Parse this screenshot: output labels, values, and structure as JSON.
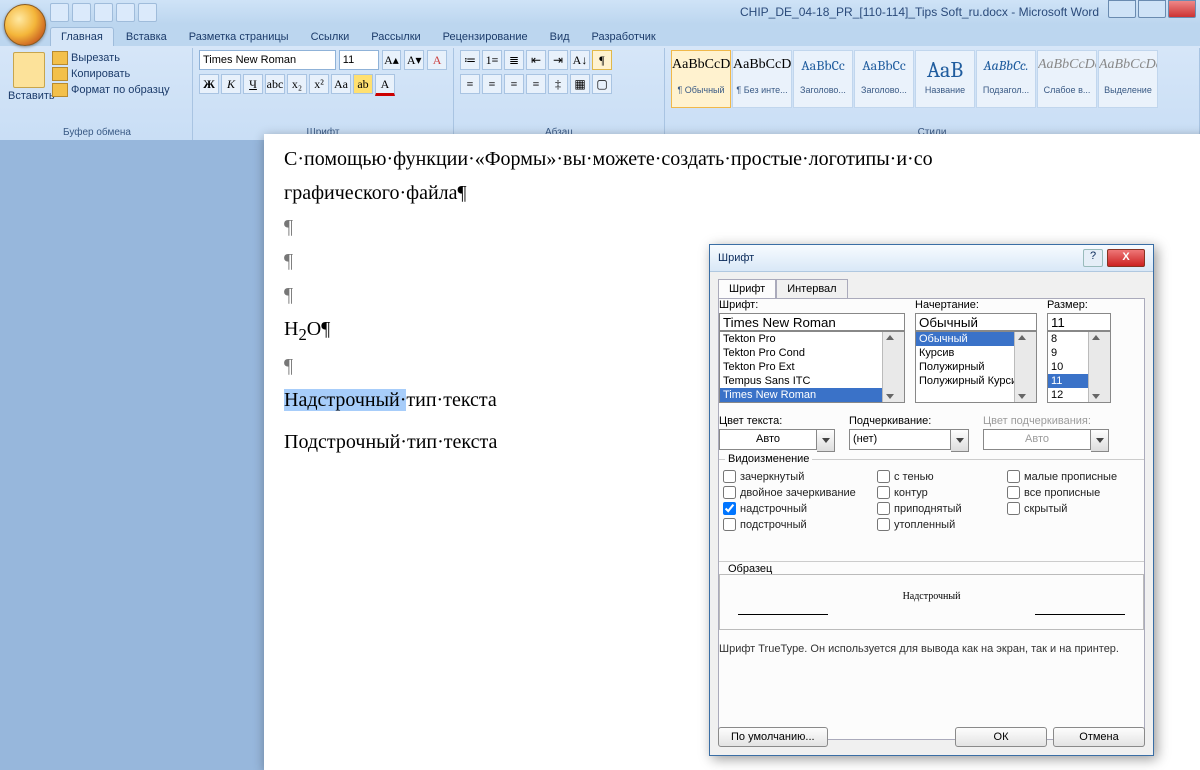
{
  "title_doc": "CHIP_DE_04-18_PR_[110-114]_Tips Soft_ru.docx - Microsoft Word",
  "tabs": [
    "Главная",
    "Вставка",
    "Разметка страницы",
    "Ссылки",
    "Рассылки",
    "Рецензирование",
    "Вид",
    "Разработчик"
  ],
  "ribbon": {
    "paste": "Вставить",
    "cut": "Вырезать",
    "copy": "Копировать",
    "format_painter": "Формат по образцу",
    "group_clipboard": "Буфер обмена",
    "font_name": "Times New Roman",
    "font_size": "11",
    "group_font": "Шрифт",
    "group_para": "Абзац",
    "group_styles": "Стили",
    "styles": [
      {
        "prev": "AaBbCcDd",
        "name": "¶ Обычный",
        "sel": true
      },
      {
        "prev": "AaBbCcDd",
        "name": "¶ Без инте..."
      },
      {
        "prev": "AaBbCc",
        "name": "Заголово...",
        "blue": true
      },
      {
        "prev": "AaBbCc",
        "name": "Заголово...",
        "blue": true
      },
      {
        "prev": "AaB",
        "name": "Название",
        "blue": true,
        "big": true
      },
      {
        "prev": "AaBbCc.",
        "name": "Подзагол...",
        "blue": true,
        "it": true
      },
      {
        "prev": "AaBbCcDd",
        "name": "Слабое в...",
        "it": true,
        "gray": true
      },
      {
        "prev": "AaBbCcDd",
        "name": "Выделение",
        "it": true,
        "gray": true
      }
    ]
  },
  "doc": {
    "line1a": "С·помощью·функции·«Формы»·вы·можете·создать·простые·логотипы·и·со",
    "line1b": "графического·файла¶",
    "h2o_a": "H",
    "h2o_b": "2",
    "h2o_c": "O¶",
    "sel": "Надстрочный·",
    "line3": "тип·текста",
    "line4": "Подстрочный·тип·текста"
  },
  "dlg": {
    "title": "Шрифт",
    "tab_font": "Шрифт",
    "tab_spacing": "Интервал",
    "lbl_font": "Шрифт:",
    "lbl_style": "Начертание:",
    "lbl_size": "Размер:",
    "font_val": "Times New Roman",
    "font_list": [
      "Tekton Pro",
      "Tekton Pro Cond",
      "Tekton Pro Ext",
      "Tempus Sans ITC",
      "Times New Roman"
    ],
    "style_val": "Обычный",
    "style_list": [
      "Обычный",
      "Курсив",
      "Полужирный",
      "Полужирный Курсив"
    ],
    "size_val": "11",
    "size_list": [
      "8",
      "9",
      "10",
      "11",
      "12"
    ],
    "lbl_color": "Цвет текста:",
    "color_val": "Авто",
    "lbl_underline": "Подчеркивание:",
    "underline_val": "(нет)",
    "lbl_ucolor": "Цвет подчеркивания:",
    "ucolor_val": "Авто",
    "effects_lbl": "Видоизменение",
    "fx": {
      "strike": "зачеркнутый",
      "dstrike": "двойное зачеркивание",
      "super": "надстрочный",
      "sub": "подстрочный",
      "shadow": "с тенью",
      "outline": "контур",
      "emboss": "приподнятый",
      "engrave": "утопленный",
      "smallcaps": "малые прописные",
      "allcaps": "все прописные",
      "hidden": "скрытый"
    },
    "sample_lbl": "Образец",
    "sample_text": "Надстрочный",
    "hint": "Шрифт TrueType. Он используется для вывода как на экран, так и на принтер.",
    "btn_default": "По умолчанию...",
    "btn_ok": "ОК",
    "btn_cancel": "Отмена"
  }
}
